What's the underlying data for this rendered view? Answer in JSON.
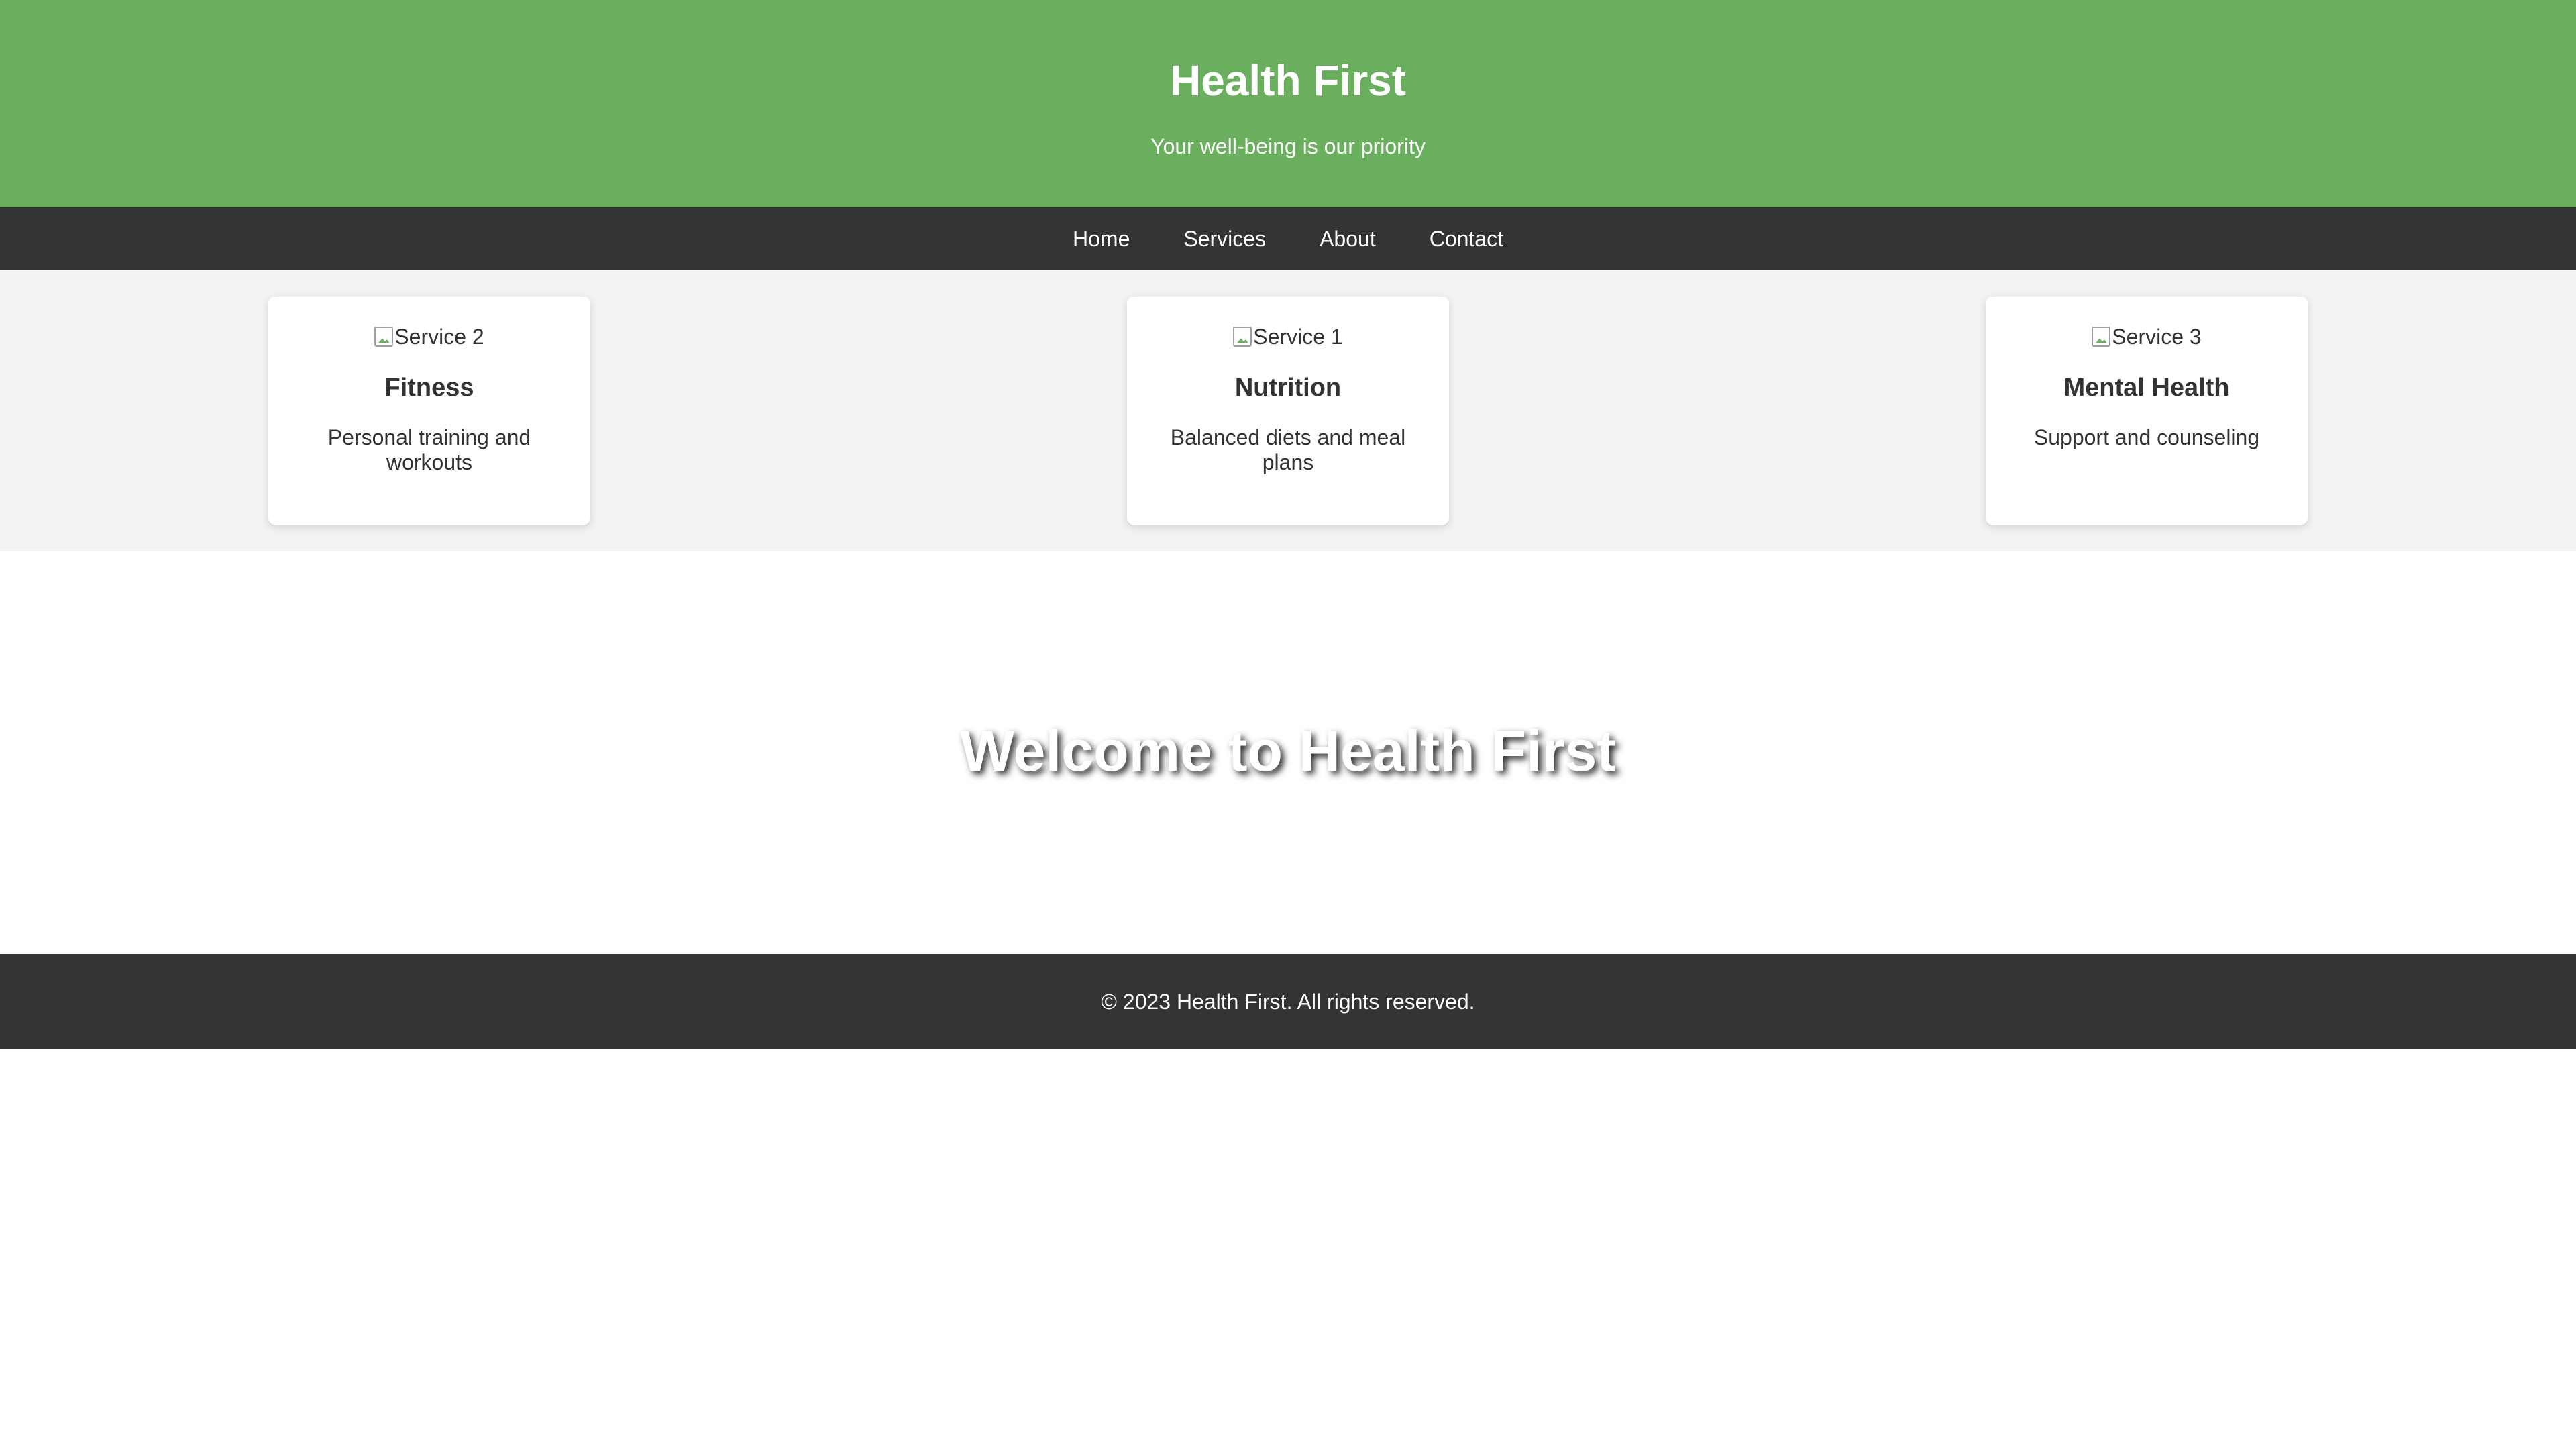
{
  "header": {
    "title": "Health First",
    "tagline": "Your well-being is our priority"
  },
  "nav": {
    "items": [
      {
        "label": "Home"
      },
      {
        "label": "Services"
      },
      {
        "label": "About"
      },
      {
        "label": "Contact"
      }
    ]
  },
  "services": {
    "cards": [
      {
        "image_alt": "Service 2",
        "title": "Fitness",
        "description": "Personal training and workouts"
      },
      {
        "image_alt": "Service 1",
        "title": "Nutrition",
        "description": "Balanced diets and meal plans"
      },
      {
        "image_alt": "Service 3",
        "title": "Mental Health",
        "description": "Support and counseling"
      }
    ]
  },
  "hero": {
    "title": "Welcome to Health First"
  },
  "footer": {
    "text": "© 2023 Health First. All rights reserved."
  },
  "colors": {
    "header_bg": "#6aaf5e",
    "nav_bg": "#333333",
    "services_bg": "#f3f3f3",
    "footer_bg": "#333333"
  }
}
